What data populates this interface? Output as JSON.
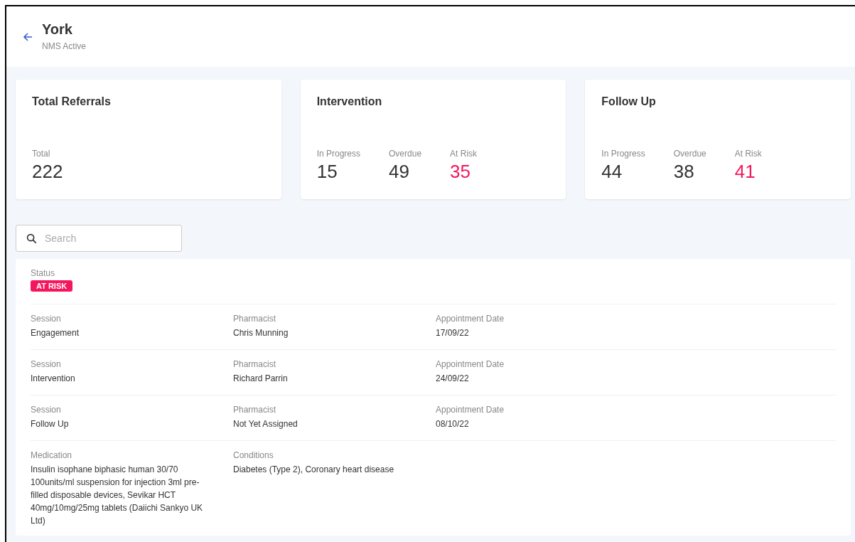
{
  "header": {
    "title": "York",
    "subtitle": "NMS Active"
  },
  "cards": [
    {
      "title": "Total Referrals",
      "metrics": [
        {
          "label": "Total",
          "value": "222",
          "alert": false
        }
      ]
    },
    {
      "title": "Intervention",
      "metrics": [
        {
          "label": "In Progress",
          "value": "15",
          "alert": false
        },
        {
          "label": "Overdue",
          "value": "49",
          "alert": false
        },
        {
          "label": "At Risk",
          "value": "35",
          "alert": true
        }
      ]
    },
    {
      "title": "Follow Up",
      "metrics": [
        {
          "label": "In Progress",
          "value": "44",
          "alert": false
        },
        {
          "label": "Overdue",
          "value": "38",
          "alert": false
        },
        {
          "label": "At Risk",
          "value": "41",
          "alert": true
        }
      ]
    }
  ],
  "search": {
    "placeholder": "Search"
  },
  "detail": {
    "rows": [
      {
        "fields": [
          {
            "kind": "badge",
            "label": "Status",
            "value": "AT RISK"
          }
        ]
      },
      {
        "fields": [
          {
            "kind": "text",
            "label": "Session",
            "value": "Engagement"
          },
          {
            "kind": "text",
            "label": "Pharmacist",
            "value": "Chris Munning"
          },
          {
            "kind": "text",
            "label": "Appointment Date",
            "value": "17/09/22"
          }
        ]
      },
      {
        "fields": [
          {
            "kind": "text",
            "label": "Session",
            "value": "Intervention"
          },
          {
            "kind": "text",
            "label": "Pharmacist",
            "value": "Richard Parrin"
          },
          {
            "kind": "text",
            "label": "Appointment Date",
            "value": "24/09/22"
          }
        ]
      },
      {
        "fields": [
          {
            "kind": "text",
            "label": "Session",
            "value": "Follow Up"
          },
          {
            "kind": "text",
            "label": "Pharmacist",
            "value": "Not Yet Assigned"
          },
          {
            "kind": "text",
            "label": "Appointment Date",
            "value": "08/10/22"
          }
        ]
      },
      {
        "fields": [
          {
            "kind": "text",
            "label": "Medication",
            "value": "Insulin isophane biphasic human 30/70 100units/ml suspension for injection 3ml pre-filled disposable devices, Sevikar HCT 40mg/10mg/25mg tablets (Daiichi Sankyo UK Ltd)"
          },
          {
            "kind": "text",
            "label": "Conditions",
            "value": "Diabetes (Type 2), Coronary heart disease"
          }
        ]
      }
    ]
  }
}
